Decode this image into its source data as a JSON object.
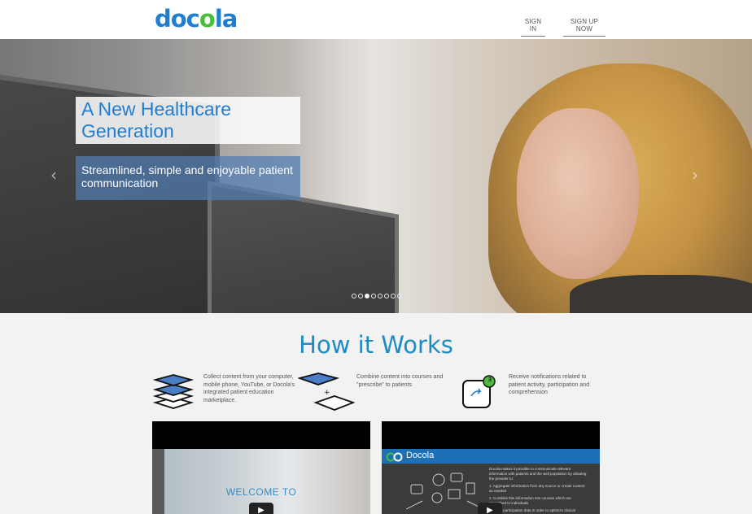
{
  "header": {
    "logo_left": "doc",
    "logo_mid": "o",
    "logo_right": "la",
    "signin_label": "SIGN IN",
    "signup_label": "SIGN UP NOW"
  },
  "hero": {
    "title_line1": "A New Healthcare",
    "title_line2": "Generation",
    "subtitle_line1": "Streamlined, simple and enjoyable patient",
    "subtitle_line2": "communication",
    "prev_arrow": "‹",
    "next_arrow": "›",
    "slide_count": 8,
    "active_slide": 3
  },
  "how_it_works": {
    "title": "How it Works",
    "steps": [
      {
        "icon": "layers-icon",
        "text": "Collect content from your computer, mobile phone, YouTube, or Docola's integrated patient education marketplace."
      },
      {
        "icon": "combine-icon",
        "text": "Combine content into courses and \"prescribe\" to patients"
      },
      {
        "icon": "notification-icon",
        "text": "Receive notifications related to patient activity, participation and comprehension",
        "badge": "3"
      }
    ]
  },
  "videos": {
    "video1_text": "WELCOME TO",
    "video2_brand": "Docola",
    "video2_text_1": "Docola makes it possible to communicate relevant information with patients and the well population by allowing the provider to:",
    "video2_text_2": "1. Aggregate information from any source or create content as needed",
    "video2_text_3": "2. Combine this information into courses which are prescribed to individuals",
    "video2_text_4": "3. Track participation data in order to optimize clinical",
    "play_glyph": "▶"
  },
  "colors": {
    "brand_blue": "#1f7ed1",
    "brand_green": "#4cbc3c",
    "title_blue": "#1e8bc3"
  }
}
